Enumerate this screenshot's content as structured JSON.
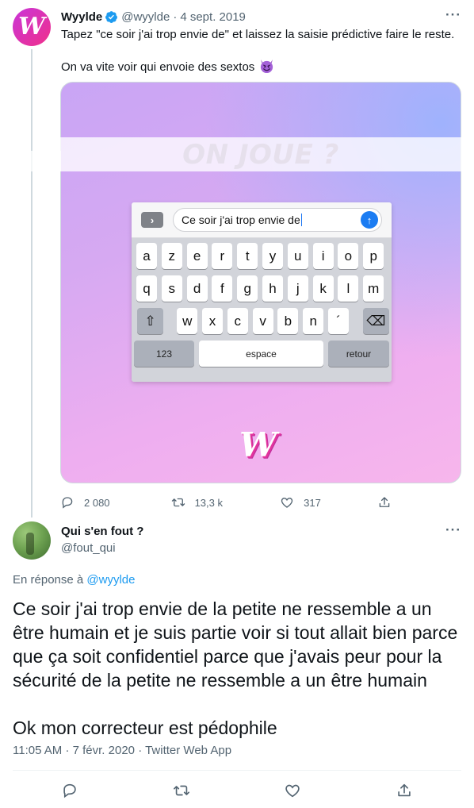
{
  "original_tweet": {
    "avatar_letter": "W",
    "author_name": "Wyylde",
    "handle": "@wyylde",
    "separator": "·",
    "date": "4 sept. 2019",
    "more": "···",
    "text_line1": "Tapez \"ce soir j'ai trop envie de\" et laissez la saisie prédictive faire le reste.",
    "text_line2": "On va vite voir qui envoie des sextos",
    "emoji_icon": "smiling-devil-emoji",
    "media": {
      "banner_text": "ON JOUE ?",
      "input_text": "Ce soir j'ai trop envie de",
      "keyboard_row1": [
        "a",
        "z",
        "e",
        "r",
        "t",
        "y",
        "u",
        "i",
        "o",
        "p"
      ],
      "keyboard_row2": [
        "q",
        "s",
        "d",
        "f",
        "g",
        "h",
        "j",
        "k",
        "l",
        "m"
      ],
      "keyboard_row3": [
        "w",
        "x",
        "c",
        "v",
        "b",
        "n",
        "´"
      ],
      "key_123": "123",
      "key_space": "espace",
      "key_return": "retour",
      "logo_letter": "W"
    },
    "stats": {
      "replies": "2 080",
      "retweets": "13,3 k",
      "likes": "317"
    }
  },
  "reply_tweet": {
    "author_name": "Qui s'en fout ?",
    "handle": "@fout_qui",
    "more": "···",
    "replying_prefix": "En réponse à",
    "replying_to": "@wyylde",
    "text_paragraph1": "Ce soir j'ai trop envie de la petite ne ressemble a un être humain et je suis partie voir si tout allait bien parce que ça soit confidentiel parce que j'avais peur pour la sécurité de la petite ne ressemble a un être humain",
    "text_paragraph2": "Ok mon correcteur est pédophile",
    "time": "11:05 AM",
    "date": "7 févr. 2020",
    "source": "Twitter Web App",
    "separator": "·"
  },
  "colors": {
    "accent": "#1d9bf0",
    "muted": "#536471",
    "text": "#0f1419",
    "brand_gradient_start": "#c935d9",
    "brand_gradient_end": "#f0308a"
  }
}
